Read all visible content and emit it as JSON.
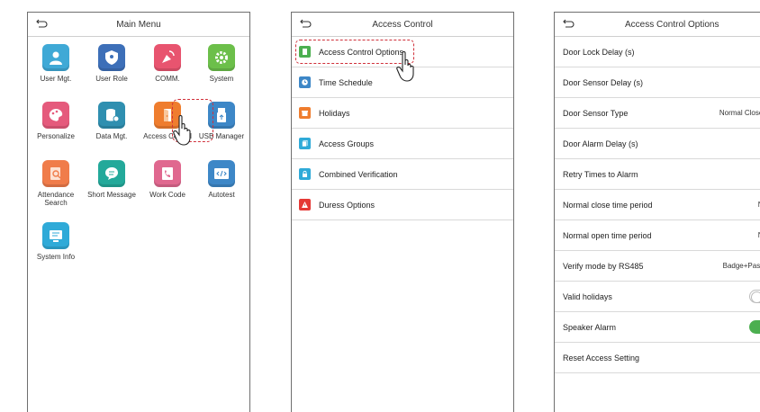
{
  "main_menu": {
    "title": "Main Menu",
    "tiles": [
      {
        "label": "User Mgt.",
        "color": "#3fa9d6"
      },
      {
        "label": "User Role",
        "color": "#3d6fb8"
      },
      {
        "label": "COMM.",
        "color": "#e8546f"
      },
      {
        "label": "System",
        "color": "#6cbf4a"
      },
      {
        "label": "Personalize",
        "color": "#e55a7c"
      },
      {
        "label": "Data Mgt.",
        "color": "#2f8fb0"
      },
      {
        "label": "Access Control",
        "color": "#ef7d2e"
      },
      {
        "label": "USB Manager",
        "color": "#3d87c7"
      },
      {
        "label": "Attendance Search",
        "color": "#f07c4a"
      },
      {
        "label": "Short Message",
        "color": "#23a99a"
      },
      {
        "label": "Work Code",
        "color": "#e0688f"
      },
      {
        "label": "Autotest",
        "color": "#3d87c7"
      },
      {
        "label": "System Info",
        "color": "#2faad8"
      }
    ]
  },
  "access_control": {
    "title": "Access Control",
    "items": [
      {
        "label": "Access Control Options",
        "color": "#4caf50"
      },
      {
        "label": "Time Schedule",
        "color": "#3d87c7"
      },
      {
        "label": "Holidays",
        "color": "#ef7d2e"
      },
      {
        "label": "Access Groups",
        "color": "#2faad8"
      },
      {
        "label": "Combined Verification",
        "color": "#2faad8"
      },
      {
        "label": "Duress Options",
        "color": "#e53935"
      }
    ]
  },
  "options": {
    "title": "Access Control Options",
    "rows": [
      {
        "label": "Door Lock Delay (s)",
        "value": ""
      },
      {
        "label": "Door Sensor Delay (s)",
        "value": ""
      },
      {
        "label": "Door Sensor Type",
        "value": "Normal Close (N"
      },
      {
        "label": "Door Alarm Delay (s)",
        "value": ""
      },
      {
        "label": "Retry Times to Alarm",
        "value": ""
      },
      {
        "label": "Normal close time period",
        "value": "No"
      },
      {
        "label": "Normal open time period",
        "value": "No"
      },
      {
        "label": "Verify mode by RS485",
        "value": "Badge+Passw"
      },
      {
        "label": "Valid holidays",
        "value": ""
      },
      {
        "label": "Speaker Alarm",
        "value": ""
      },
      {
        "label": "Reset Access Setting",
        "value": ""
      }
    ],
    "valid_holidays_on": false,
    "speaker_alarm_on": true
  }
}
